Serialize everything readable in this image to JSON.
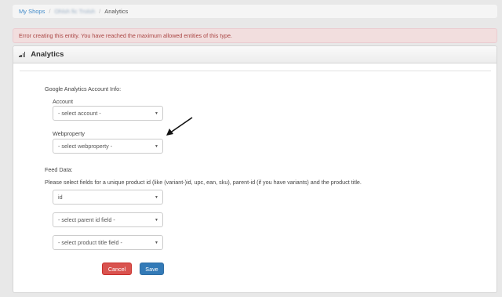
{
  "breadcrumb": {
    "home": "My Shops",
    "shop": "Ohlsh fic Trolsh",
    "current": "Analytics"
  },
  "alert": {
    "message": "Error creating this entity. You have reached the maximum allowed entities of this type."
  },
  "panel": {
    "title": "Analytics"
  },
  "ga_section": {
    "heading": "Google Analytics Account Info:",
    "account_label": "Account",
    "account_value": "- select account -",
    "webproperty_label": "Webproperty",
    "webproperty_value": "- select webproperty -"
  },
  "feed_section": {
    "heading": "Feed Data:",
    "instructions": "Please select fields for a unique product id (like (variant-)id, upc, ean, sku), parent-id (if you have variants) and the product title.",
    "id_field_value": "id",
    "parent_field_value": "- select parent id field -",
    "title_field_value": "- select product title field -"
  },
  "actions": {
    "cancel_label": "Cancel",
    "save_label": "Save"
  },
  "colors": {
    "danger": "#d9534f",
    "primary": "#337ab7",
    "alert_bg": "#f2dede",
    "alert_text": "#a94442",
    "link": "#428bca"
  }
}
